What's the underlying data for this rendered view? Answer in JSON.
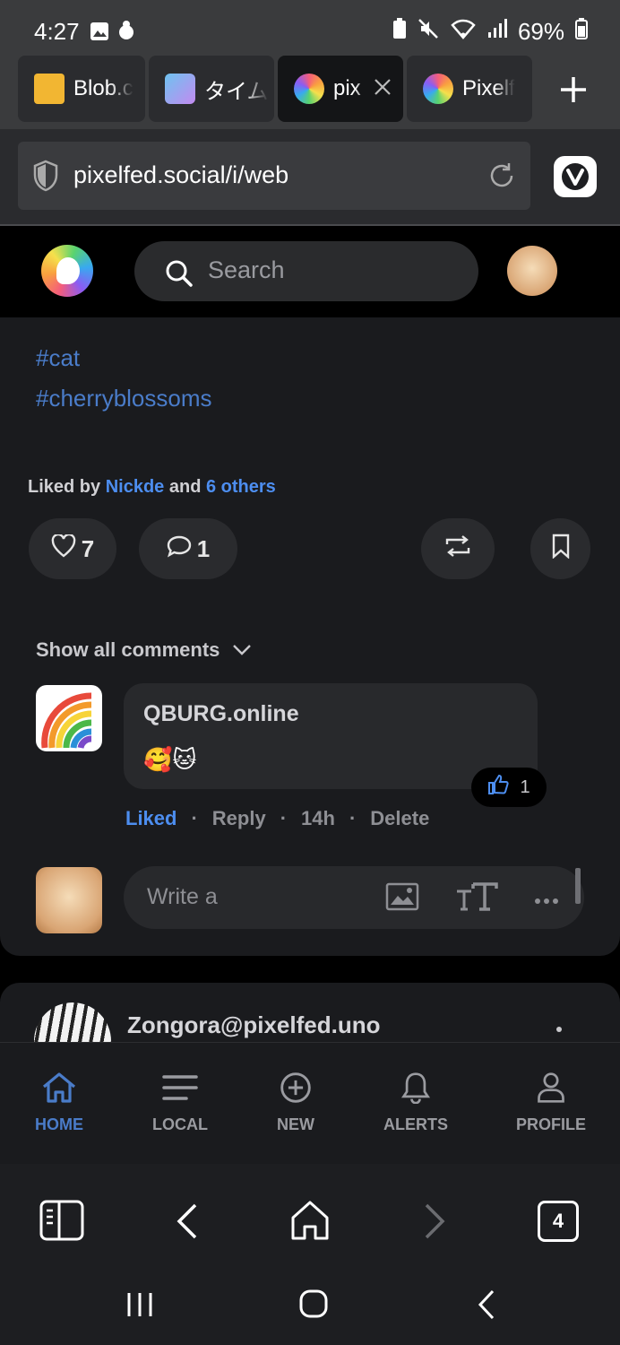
{
  "status_bar": {
    "time": "4:27",
    "battery": "69%"
  },
  "tabs": [
    {
      "label": "Blob.c",
      "icon": "blobcat-icon"
    },
    {
      "label": "タイム",
      "icon": "tiime-icon"
    },
    {
      "label": "pix",
      "icon": "pixelfed-icon",
      "active": true
    },
    {
      "label": "Pixelf",
      "icon": "pixelfed-icon"
    }
  ],
  "url": "pixelfed.social/i/web",
  "search": {
    "placeholder": "Search"
  },
  "post": {
    "hashtags": [
      "#cat",
      "#cherryblossoms"
    ],
    "liked_by": {
      "prefix": "Liked by",
      "user": "Nickde",
      "middle": "and",
      "others": "6 others"
    },
    "like_count": "7",
    "comment_count": "1",
    "show_all_comments": "Show all comments",
    "comment": {
      "author": "QBURG.online",
      "body": "🥰🐱",
      "likes": "1",
      "actions": {
        "liked": "Liked",
        "reply": "Reply",
        "time": "14h",
        "delete": "Delete"
      }
    },
    "write_placeholder": "Write a"
  },
  "next_post": {
    "author": "Zongora@pixelfed.uno"
  },
  "bottom_nav": [
    {
      "label": "HOME",
      "icon": "home-icon",
      "active": true
    },
    {
      "label": "LOCAL",
      "icon": "menu-icon"
    },
    {
      "label": "NEW",
      "icon": "plus-circle-icon"
    },
    {
      "label": "ALERTS",
      "icon": "bell-icon"
    },
    {
      "label": "PROFILE",
      "icon": "user-icon"
    }
  ],
  "browser_toolbar": {
    "tab_count": "4"
  },
  "colors": {
    "accent": "#4a7cc9",
    "link": "#4d8ef0"
  }
}
